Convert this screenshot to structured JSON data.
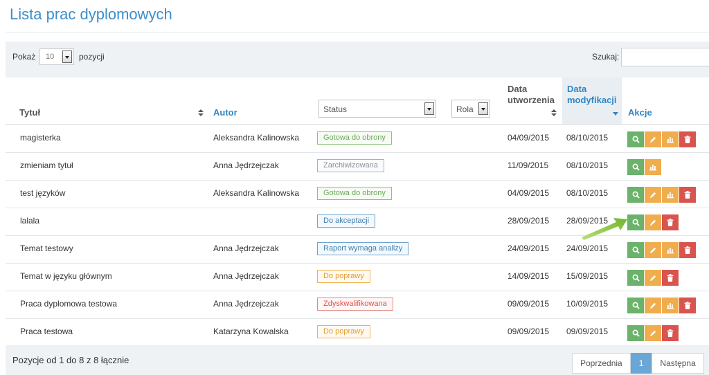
{
  "page_title": "Lista prac dyplomowych",
  "toolbar": {
    "show_label": "Pokaż",
    "page_length": "10",
    "entries_label": "pozycji",
    "search_label": "Szukaj:",
    "search_value": ""
  },
  "table": {
    "headers": {
      "title": "Tytuł",
      "author": "Autor",
      "status": "Status",
      "role": "Rola",
      "created_line1": "Data",
      "created_line2": "utworzenia",
      "modified_line1": "Data",
      "modified_line2": "modyfikacji",
      "actions": "Akcje"
    },
    "rows": [
      {
        "title": "magisterka",
        "author": "Aleksandra Kalinowska",
        "status": "Gotowa do obrony",
        "created": "04/09/2015",
        "modified": "08/10/2015"
      },
      {
        "title": "zmieniam tytuł",
        "author": "Anna Jędrzejczak",
        "status": "Zarchiwizowana",
        "created": "11/09/2015",
        "modified": "08/10/2015"
      },
      {
        "title": "test języków",
        "author": "Aleksandra Kalinowska",
        "status": "Gotowa do obrony",
        "created": "04/09/2015",
        "modified": "08/10/2015"
      },
      {
        "title": "lalala",
        "author": "",
        "status": "Do akceptacji",
        "created": "28/09/2015",
        "modified": "28/09/2015"
      },
      {
        "title": "Temat testowy",
        "author": "Anna Jędrzejczak",
        "status": "Raport wymaga analizy",
        "created": "24/09/2015",
        "modified": "24/09/2015"
      },
      {
        "title": "Temat w języku głównym",
        "author": "Anna Jędrzejczak",
        "status": "Do poprawy",
        "created": "14/09/2015",
        "modified": "15/09/2015"
      },
      {
        "title": "Praca dyplomowa testowa",
        "author": "Anna Jędrzejczak",
        "status": "Zdyskwalifikowana",
        "created": "09/09/2015",
        "modified": "10/09/2015"
      },
      {
        "title": "Praca testowa",
        "author": "Katarzyna Kowalska",
        "status": "Do poprawy",
        "created": "09/09/2015",
        "modified": "09/09/2015"
      }
    ]
  },
  "footer": {
    "info": "Pozycje od 1 do 8 z 8 łącznie",
    "prev": "Poprzednia",
    "current_page": "1",
    "next": "Następna"
  },
  "colors": {
    "accent_blue": "#3a8ecb",
    "view_button": "#6bb26b",
    "edit_button": "#f0ad4e",
    "delete_button": "#d9534f",
    "highlight_arrow": "#8dc63f"
  }
}
